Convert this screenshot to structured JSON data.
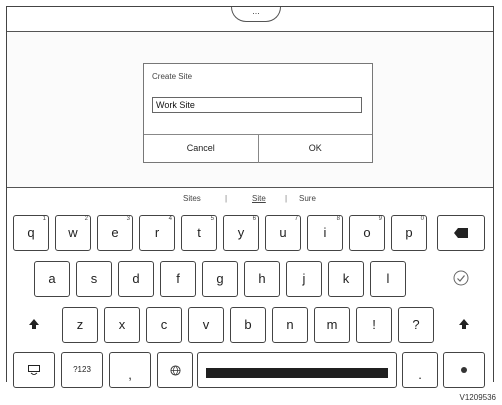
{
  "topbar": {
    "handle_glyph": "..."
  },
  "dialog": {
    "title": "Create Site",
    "input_value": "Work Site",
    "cancel_label": "Cancel",
    "ok_label": "OK"
  },
  "suggestions": [
    "Sites",
    "Site",
    "Sure"
  ],
  "keyboard": {
    "row1": [
      {
        "label": "q",
        "hint": "1"
      },
      {
        "label": "w",
        "hint": "2"
      },
      {
        "label": "e",
        "hint": "3"
      },
      {
        "label": "r",
        "hint": "4"
      },
      {
        "label": "t",
        "hint": "5"
      },
      {
        "label": "y",
        "hint": "6"
      },
      {
        "label": "u",
        "hint": "7"
      },
      {
        "label": "i",
        "hint": "8"
      },
      {
        "label": "o",
        "hint": "9"
      },
      {
        "label": "p",
        "hint": "0"
      }
    ],
    "row2": [
      "a",
      "s",
      "d",
      "f",
      "g",
      "h",
      "j",
      "k",
      "l"
    ],
    "row3": [
      "z",
      "x",
      "c",
      "v",
      "b",
      "n",
      "m",
      "!",
      "?"
    ],
    "symbols_label": "?123",
    "comma_label": ",",
    "period_label": "."
  },
  "footer": {
    "code": "V1209536"
  }
}
